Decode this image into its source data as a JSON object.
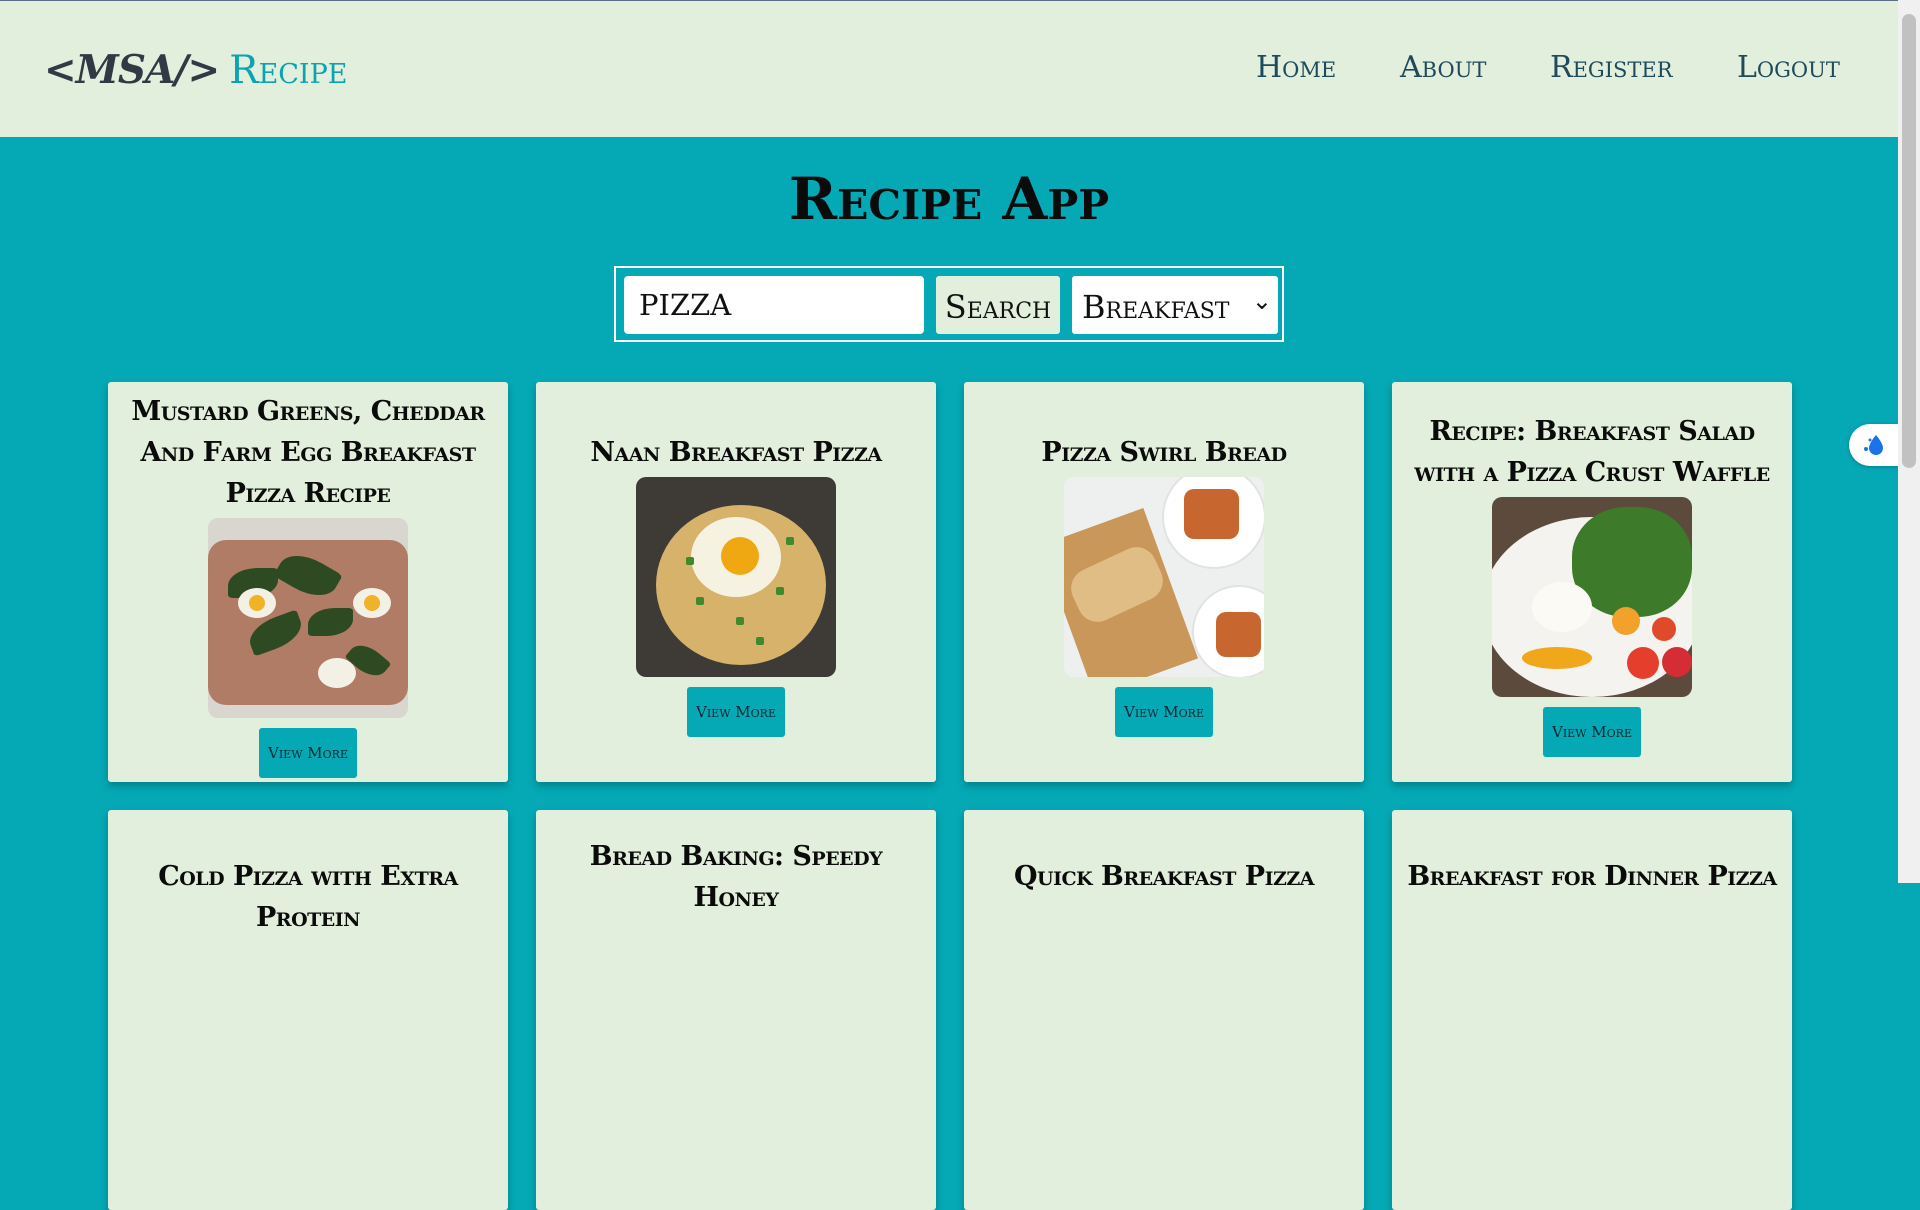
{
  "navbar": {
    "logo_bracket": "<MSA/>",
    "logo_brand": "Recipe",
    "links": [
      "Home",
      "About",
      "Register",
      "Logout"
    ]
  },
  "main": {
    "title": "Recipe App"
  },
  "search": {
    "query": "PIZZA",
    "button_label": "Search",
    "category": "Breakfast"
  },
  "cards": [
    {
      "title": "Mustard Greens, Cheddar And Farm Egg Breakfast Pizza Recipe",
      "button": "View More"
    },
    {
      "title": "Naan Breakfast Pizza",
      "button": "View More"
    },
    {
      "title": "Pizza Swirl Bread",
      "button": "View More"
    },
    {
      "title": "Recipe: Breakfast Salad with a Pizza Crust Waffle",
      "button": "View More"
    },
    {
      "title": "Cold Pizza with Extra Protein"
    },
    {
      "title": "Bread Baking: Speedy Honey"
    },
    {
      "title": "Quick Breakfast Pizza"
    },
    {
      "title": "Breakfast for Dinner Pizza"
    }
  ],
  "colors": {
    "accent": "#04a9b5",
    "panel": "#e2efdc",
    "nav_text": "#1e4a5c"
  }
}
